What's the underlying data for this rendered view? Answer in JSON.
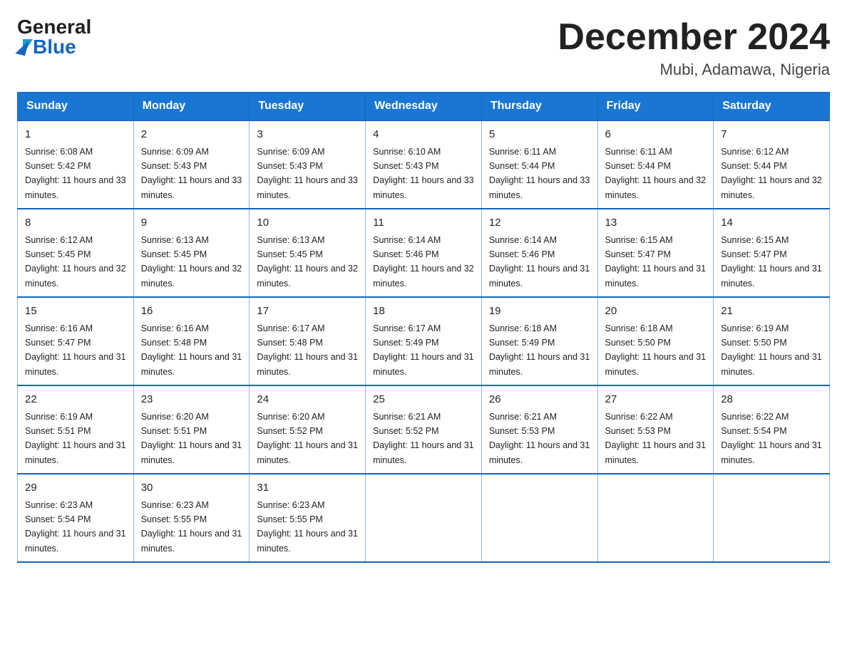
{
  "header": {
    "logo_general": "General",
    "logo_blue": "Blue",
    "month_title": "December 2024",
    "location": "Mubi, Adamawa, Nigeria"
  },
  "weekdays": [
    "Sunday",
    "Monday",
    "Tuesday",
    "Wednesday",
    "Thursday",
    "Friday",
    "Saturday"
  ],
  "weeks": [
    [
      {
        "day": "1",
        "sunrise": "6:08 AM",
        "sunset": "5:42 PM",
        "daylight": "11 hours and 33 minutes."
      },
      {
        "day": "2",
        "sunrise": "6:09 AM",
        "sunset": "5:43 PM",
        "daylight": "11 hours and 33 minutes."
      },
      {
        "day": "3",
        "sunrise": "6:09 AM",
        "sunset": "5:43 PM",
        "daylight": "11 hours and 33 minutes."
      },
      {
        "day": "4",
        "sunrise": "6:10 AM",
        "sunset": "5:43 PM",
        "daylight": "11 hours and 33 minutes."
      },
      {
        "day": "5",
        "sunrise": "6:11 AM",
        "sunset": "5:44 PM",
        "daylight": "11 hours and 33 minutes."
      },
      {
        "day": "6",
        "sunrise": "6:11 AM",
        "sunset": "5:44 PM",
        "daylight": "11 hours and 32 minutes."
      },
      {
        "day": "7",
        "sunrise": "6:12 AM",
        "sunset": "5:44 PM",
        "daylight": "11 hours and 32 minutes."
      }
    ],
    [
      {
        "day": "8",
        "sunrise": "6:12 AM",
        "sunset": "5:45 PM",
        "daylight": "11 hours and 32 minutes."
      },
      {
        "day": "9",
        "sunrise": "6:13 AM",
        "sunset": "5:45 PM",
        "daylight": "11 hours and 32 minutes."
      },
      {
        "day": "10",
        "sunrise": "6:13 AM",
        "sunset": "5:45 PM",
        "daylight": "11 hours and 32 minutes."
      },
      {
        "day": "11",
        "sunrise": "6:14 AM",
        "sunset": "5:46 PM",
        "daylight": "11 hours and 32 minutes."
      },
      {
        "day": "12",
        "sunrise": "6:14 AM",
        "sunset": "5:46 PM",
        "daylight": "11 hours and 31 minutes."
      },
      {
        "day": "13",
        "sunrise": "6:15 AM",
        "sunset": "5:47 PM",
        "daylight": "11 hours and 31 minutes."
      },
      {
        "day": "14",
        "sunrise": "6:15 AM",
        "sunset": "5:47 PM",
        "daylight": "11 hours and 31 minutes."
      }
    ],
    [
      {
        "day": "15",
        "sunrise": "6:16 AM",
        "sunset": "5:47 PM",
        "daylight": "11 hours and 31 minutes."
      },
      {
        "day": "16",
        "sunrise": "6:16 AM",
        "sunset": "5:48 PM",
        "daylight": "11 hours and 31 minutes."
      },
      {
        "day": "17",
        "sunrise": "6:17 AM",
        "sunset": "5:48 PM",
        "daylight": "11 hours and 31 minutes."
      },
      {
        "day": "18",
        "sunrise": "6:17 AM",
        "sunset": "5:49 PM",
        "daylight": "11 hours and 31 minutes."
      },
      {
        "day": "19",
        "sunrise": "6:18 AM",
        "sunset": "5:49 PM",
        "daylight": "11 hours and 31 minutes."
      },
      {
        "day": "20",
        "sunrise": "6:18 AM",
        "sunset": "5:50 PM",
        "daylight": "11 hours and 31 minutes."
      },
      {
        "day": "21",
        "sunrise": "6:19 AM",
        "sunset": "5:50 PM",
        "daylight": "11 hours and 31 minutes."
      }
    ],
    [
      {
        "day": "22",
        "sunrise": "6:19 AM",
        "sunset": "5:51 PM",
        "daylight": "11 hours and 31 minutes."
      },
      {
        "day": "23",
        "sunrise": "6:20 AM",
        "sunset": "5:51 PM",
        "daylight": "11 hours and 31 minutes."
      },
      {
        "day": "24",
        "sunrise": "6:20 AM",
        "sunset": "5:52 PM",
        "daylight": "11 hours and 31 minutes."
      },
      {
        "day": "25",
        "sunrise": "6:21 AM",
        "sunset": "5:52 PM",
        "daylight": "11 hours and 31 minutes."
      },
      {
        "day": "26",
        "sunrise": "6:21 AM",
        "sunset": "5:53 PM",
        "daylight": "11 hours and 31 minutes."
      },
      {
        "day": "27",
        "sunrise": "6:22 AM",
        "sunset": "5:53 PM",
        "daylight": "11 hours and 31 minutes."
      },
      {
        "day": "28",
        "sunrise": "6:22 AM",
        "sunset": "5:54 PM",
        "daylight": "11 hours and 31 minutes."
      }
    ],
    [
      {
        "day": "29",
        "sunrise": "6:23 AM",
        "sunset": "5:54 PM",
        "daylight": "11 hours and 31 minutes."
      },
      {
        "day": "30",
        "sunrise": "6:23 AM",
        "sunset": "5:55 PM",
        "daylight": "11 hours and 31 minutes."
      },
      {
        "day": "31",
        "sunrise": "6:23 AM",
        "sunset": "5:55 PM",
        "daylight": "11 hours and 31 minutes."
      },
      null,
      null,
      null,
      null
    ]
  ]
}
